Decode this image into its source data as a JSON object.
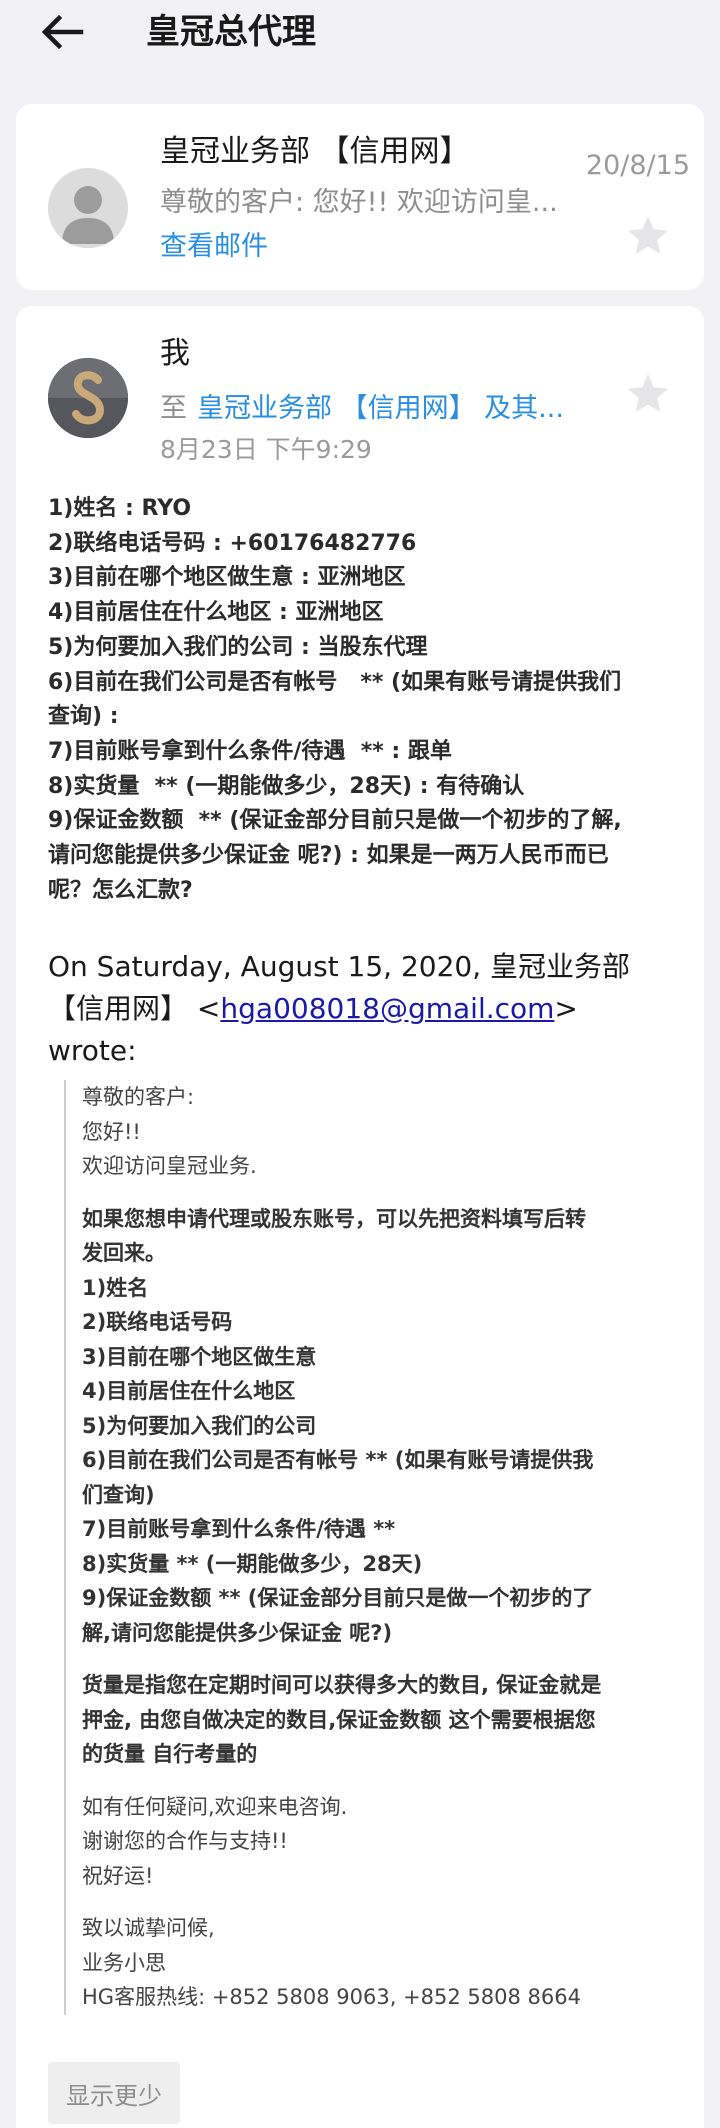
{
  "header": {
    "title": "皇冠总代理"
  },
  "card1": {
    "sender": "皇冠业务部 【信用网】",
    "date": "20/8/15",
    "preview": "尊敬的客户: 您好!! 欢迎访问皇...",
    "view_link": "查看邮件"
  },
  "card2": {
    "sender": "我",
    "to_label": "至",
    "recipients": "皇冠业务部 【信用网】 及其...",
    "date": "8月23日 下午9:29",
    "reply_lines": [
      "1)姓名 : RYO",
      "2)联络电话号码 : +60176482776",
      "3)目前在哪个地区做生意 : 亚洲地区",
      "4)目前居住在什么地区 : 亚洲地区",
      "5)为何要加入我们的公司 : 当股东代理",
      "6)目前在我们公司是否有帐号   ** (如果有账号请提供我们",
      "查询) :",
      "7)目前账号拿到什么条件/待遇  ** : 跟单",
      "8)实货量  ** (一期能做多少，28天) : 有待确认",
      "9)保证金数额  ** (保证金部分目前只是做一个初步的了解,",
      "请问您能提供多少保证金 呢?) : 如果是一两万人民币而已",
      "呢？怎么汇款?"
    ],
    "on_wrote_prefix": "On Saturday, August 15, 2020, 皇冠业务部",
    "on_wrote_name": "【信用网】",
    "email": "hga008018@gmail.com",
    "wrote": "wrote:",
    "quote": {
      "greeting": [
        "尊敬的客户:",
        "您好!!",
        "欢迎访问皇冠业务."
      ],
      "intro": [
        "如果您想申请代理或股东账号，可以先把资料填写后转",
        "发回来。"
      ],
      "fields": [
        "1)姓名",
        "2)联络电话号码",
        "3)目前在哪个地区做生意",
        "4)目前居住在什么地区",
        "5)为何要加入我们的公司",
        "6)目前在我们公司是否有帐号   ** (如果有账号请提供我",
        "们查询)",
        "7)目前账号拿到什么条件/待遇  **",
        "8)实货量  ** (一期能做多少，28天)",
        "9)保证金数额  ** (保证金部分目前只是做一个初步的了",
        "解,请问您能提供多少保证金 呢?)"
      ],
      "note": [
        "货量是指您在定期时间可以获得多大的数目, 保证金就是",
        "押金, 由您自做决定的数目,保证金数额 这个需要根据您",
        "的货量 自行考量的"
      ],
      "closing": [
        "如有任何疑问,欢迎来电咨询.",
        "谢谢您的合作与支持!!",
        "祝好运!"
      ],
      "signature": [
        "致以诚挚问候,",
        "业务小思",
        "HG客服热线: +852 5808 9063,  +852 5808 8664"
      ]
    },
    "show_less": "显示更少"
  }
}
